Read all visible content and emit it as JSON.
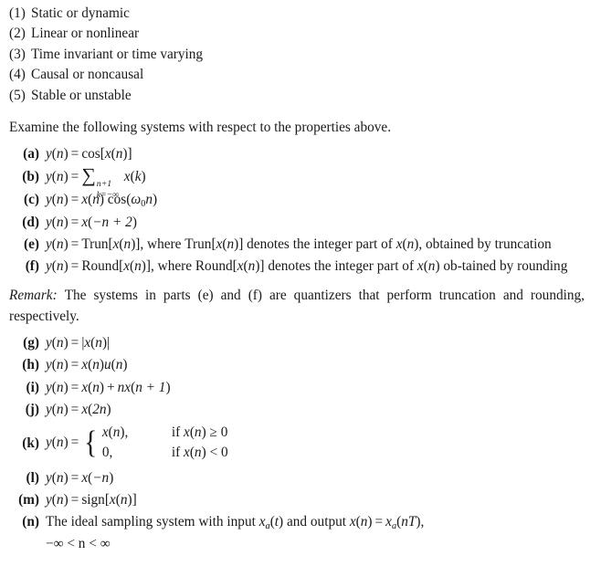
{
  "document": {
    "kind": "textbook-problem-page",
    "background_color": "#ffffff",
    "text_color": "#1a1a1a"
  },
  "properties": {
    "items": [
      {
        "num": "(1)",
        "text": "Static or dynamic"
      },
      {
        "num": "(2)",
        "text": "Linear or nonlinear"
      },
      {
        "num": "(3)",
        "text": "Time invariant or time varying"
      },
      {
        "num": "(4)",
        "text": "Causal or noncausal"
      },
      {
        "num": "(5)",
        "text": "Stable or unstable"
      }
    ]
  },
  "instruction": {
    "text": "Examine the following systems with respect to the properties above."
  },
  "systems": {
    "a": {
      "label": "(a)",
      "lhs_y": "y",
      "lhs_n": "n",
      "eq": "=",
      "fn": "cos",
      "open": "[",
      "arg_x": "x",
      "arg_n": "n",
      "close": "]"
    },
    "b": {
      "label": "(b)",
      "lhs_y": "y",
      "lhs_n": "n",
      "eq": "=",
      "sigma": "∑",
      "upper": "n+1",
      "lower": "k=−∞",
      "arg_x": "x",
      "arg_k": "k"
    },
    "c": {
      "label": "(c)",
      "lhs_y": "y",
      "lhs_n": "n",
      "eq": "=",
      "x": "x",
      "n": "n",
      "fn": "cos",
      "omega": "ω",
      "omega_sub": "0",
      "tail_n": "n"
    },
    "d": {
      "label": "(d)",
      "lhs_y": "y",
      "lhs_n": "n",
      "eq": "=",
      "x": "x",
      "arg": "−n + 2"
    },
    "e": {
      "label": "(e)",
      "lhs_y": "y",
      "lhs_n": "n",
      "eq": "=",
      "fn": "Trun",
      "x": "x",
      "n": "n",
      "text_1": "where",
      "text_2": "denotes the integer part of",
      "text_3": ", obtained by truncation"
    },
    "f": {
      "label": "(f)",
      "lhs_y": "y",
      "lhs_n": "n",
      "eq": "=",
      "fn": "Round",
      "x": "x",
      "n": "n",
      "text_1": "where",
      "text_2": "denotes the integer part of",
      "text_3": "ob-tained by rounding"
    },
    "remark": {
      "label": "Remark:",
      "text": "The systems in parts (e) and (f) are quantizers that perform truncation and rounding, respectively."
    },
    "g": {
      "label": "(g)",
      "lhs_y": "y",
      "lhs_n": "n",
      "eq": "=",
      "bar": "|",
      "x": "x",
      "n": "n"
    },
    "h": {
      "label": "(h)",
      "lhs_y": "y",
      "lhs_n": "n",
      "eq": "=",
      "x": "x",
      "u": "u",
      "n": "n"
    },
    "i": {
      "label": "(i)",
      "lhs_y": "y",
      "lhs_n": "n",
      "eq": "=",
      "x": "x",
      "n": "n",
      "plus": "+",
      "coef_n": "n",
      "x2": "x",
      "arg2": "n + 1"
    },
    "j": {
      "label": "(j)",
      "lhs_y": "y",
      "lhs_n": "n",
      "eq": "=",
      "x": "x",
      "arg": "2n"
    },
    "k": {
      "label": "(k)",
      "lhs_y": "y",
      "lhs_n": "n",
      "eq": "=",
      "brace": "{",
      "row1_value_x": "x",
      "row1_value_n": "n",
      "row1_value_comma": ",",
      "row1_if": "if",
      "row1_cond_x": "x",
      "row1_cond_n": "n",
      "row1_cond_rel": "≥ 0",
      "row2_value": "0,",
      "row2_if": "if",
      "row2_cond_x": "x",
      "row2_cond_n": "n",
      "row2_cond_rel": "< 0"
    },
    "l": {
      "label": "(l)",
      "lhs_y": "y",
      "lhs_n": "n",
      "eq": "=",
      "x": "x",
      "arg": "−n"
    },
    "m": {
      "label": "(m)",
      "lhs_y": "y",
      "lhs_n": "n",
      "eq": "=",
      "fn": "sign",
      "open": "[",
      "x": "x",
      "n": "n",
      "close": "]"
    },
    "n": {
      "label": "(n)",
      "text_1": "The ideal sampling system with input",
      "xa_x": "x",
      "xa_sub": "a",
      "xa_arg": "t",
      "text_2": "and output",
      "out_x": "x",
      "out_n": "n",
      "eq": "=",
      "rhs_x": "x",
      "rhs_sub": "a",
      "rhs_arg": "nT",
      "comma": ",",
      "range": "−∞ < n < ∞"
    }
  }
}
